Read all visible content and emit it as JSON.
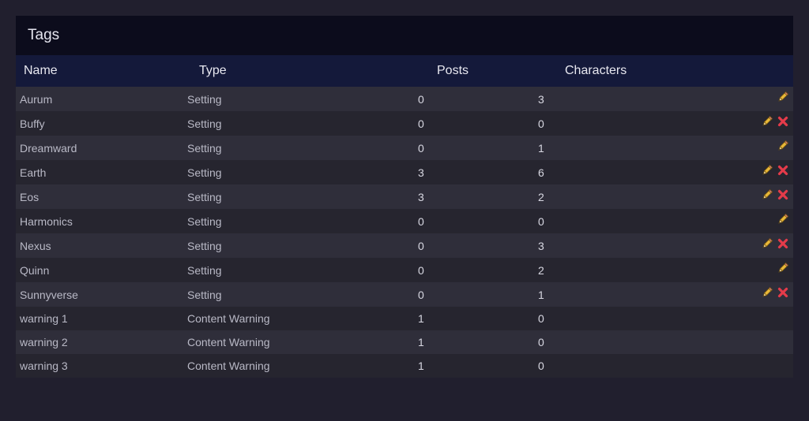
{
  "panel": {
    "title": "Tags"
  },
  "columns": {
    "name": "Name",
    "type": "Type",
    "posts": "Posts",
    "characters": "Characters"
  },
  "colors": {
    "page_bg": "#211f2e",
    "header_bg": "#0c0c1c",
    "column_header_bg": "#14193a",
    "row_odd": "#2f2e3a",
    "row_even": "#26252f",
    "edit_icon": "#e8b83a",
    "delete_icon": "#e53b4a"
  },
  "rows": [
    {
      "name": "Aurum",
      "type": "Setting",
      "posts": "0",
      "characters": "3",
      "edit": true,
      "delete": false
    },
    {
      "name": "Buffy",
      "type": "Setting",
      "posts": "0",
      "characters": "0",
      "edit": true,
      "delete": true
    },
    {
      "name": "Dreamward",
      "type": "Setting",
      "posts": "0",
      "characters": "1",
      "edit": true,
      "delete": false
    },
    {
      "name": "Earth",
      "type": "Setting",
      "posts": "3",
      "characters": "6",
      "edit": true,
      "delete": true
    },
    {
      "name": "Eos",
      "type": "Setting",
      "posts": "3",
      "characters": "2",
      "edit": true,
      "delete": true
    },
    {
      "name": "Harmonics",
      "type": "Setting",
      "posts": "0",
      "characters": "0",
      "edit": true,
      "delete": false
    },
    {
      "name": "Nexus",
      "type": "Setting",
      "posts": "0",
      "characters": "3",
      "edit": true,
      "delete": true
    },
    {
      "name": "Quinn",
      "type": "Setting",
      "posts": "0",
      "characters": "2",
      "edit": true,
      "delete": false
    },
    {
      "name": "Sunnyverse",
      "type": "Setting",
      "posts": "0",
      "characters": "1",
      "edit": true,
      "delete": true
    },
    {
      "name": "warning 1",
      "type": "Content Warning",
      "posts": "1",
      "characters": "0",
      "edit": false,
      "delete": false
    },
    {
      "name": "warning 2",
      "type": "Content Warning",
      "posts": "1",
      "characters": "0",
      "edit": false,
      "delete": false
    },
    {
      "name": "warning 3",
      "type": "Content Warning",
      "posts": "1",
      "characters": "0",
      "edit": false,
      "delete": false
    }
  ],
  "icons": {
    "edit": "pencil-icon",
    "delete": "close-icon"
  }
}
